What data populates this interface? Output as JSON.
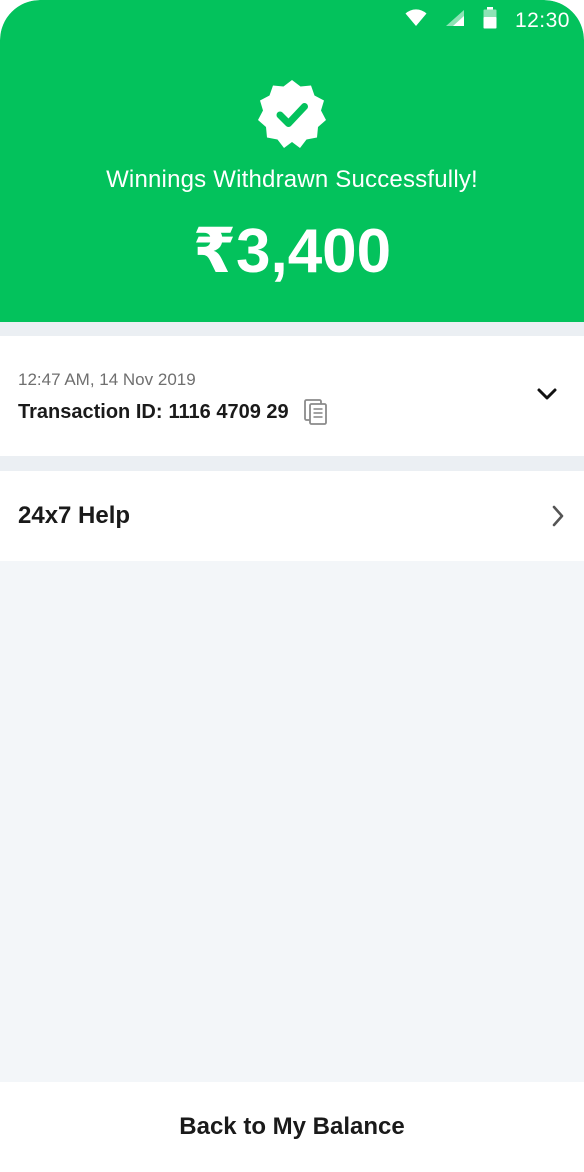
{
  "status_bar": {
    "time": "12:30",
    "icons": [
      "wifi-icon",
      "signal-icon",
      "battery-icon"
    ]
  },
  "header": {
    "badge_icon": "verified-check-icon",
    "title": "Winnings Withdrawn Successfully!",
    "amount": "₹3,400",
    "background_color": "#03c25c"
  },
  "transaction": {
    "timestamp": "12:47 AM, 14 Nov 2019",
    "id_label": "Transaction ID:",
    "id_value": "1116 4709 29",
    "copy_icon": "copy-icon",
    "expand_icon": "chevron-down-icon"
  },
  "help": {
    "label": "24x7 Help",
    "icon": "chevron-right-icon"
  },
  "footer": {
    "back_label": "Back to My Balance"
  }
}
